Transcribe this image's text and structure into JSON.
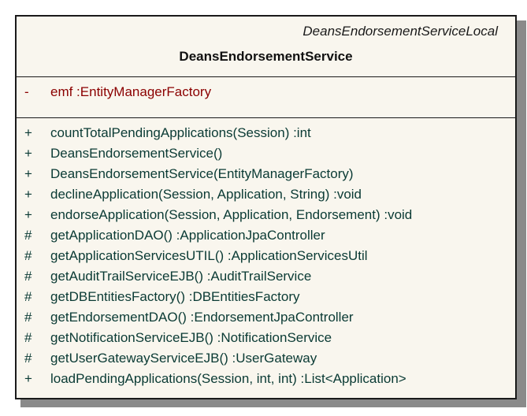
{
  "class": {
    "stereotype": "DeansEndorsementServiceLocal",
    "name": "DeansEndorsementService"
  },
  "attributes": [
    {
      "visibility": "-",
      "signature": "emf  :EntityManagerFactory"
    }
  ],
  "operations": [
    {
      "visibility": "+",
      "signature": "countTotalPendingApplications(Session)  :int"
    },
    {
      "visibility": "+",
      "signature": "DeansEndorsementService()"
    },
    {
      "visibility": "+",
      "signature": "DeansEndorsementService(EntityManagerFactory)"
    },
    {
      "visibility": "+",
      "signature": "declineApplication(Session, Application, String)  :void"
    },
    {
      "visibility": "+",
      "signature": "endorseApplication(Session, Application, Endorsement)  :void"
    },
    {
      "visibility": "#",
      "signature": "getApplicationDAO()  :ApplicationJpaController"
    },
    {
      "visibility": "#",
      "signature": "getApplicationServicesUTIL()  :ApplicationServicesUtil"
    },
    {
      "visibility": "#",
      "signature": "getAuditTrailServiceEJB()  :AuditTrailService"
    },
    {
      "visibility": "#",
      "signature": "getDBEntitiesFactory()  :DBEntitiesFactory"
    },
    {
      "visibility": "#",
      "signature": "getEndorsementDAO()  :EndorsementJpaController"
    },
    {
      "visibility": "#",
      "signature": "getNotificationServiceEJB()  :NotificationService"
    },
    {
      "visibility": "#",
      "signature": "getUserGatewayServiceEJB()  :UserGateway"
    },
    {
      "visibility": "+",
      "signature": "loadPendingApplications(Session, int, int)  :List<Application>"
    }
  ],
  "colors": {
    "fill": "#f9f6ee",
    "border": "#1a1a1a",
    "attribute_text": "#8b0000",
    "operation_text": "#0a3a34",
    "shadow": "#8a8a8a"
  }
}
